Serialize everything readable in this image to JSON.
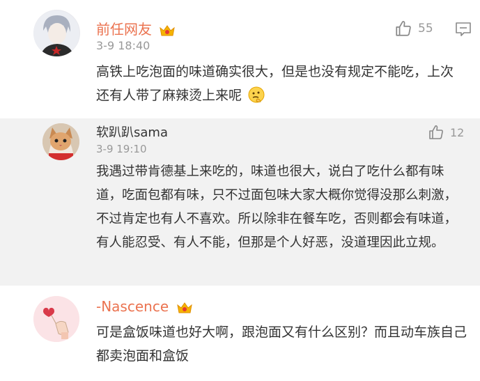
{
  "comments": [
    {
      "username": "前任网友",
      "time": "3-9 18:40",
      "likes": "55",
      "text": "高铁上吃泡面的味道确实很大，但是也没有规定不能吃，上次还有人带了麻辣烫上来呢",
      "emoji": "thinking-emoji",
      "name_color": "#eb7350"
    },
    {
      "username": "软趴趴sama",
      "time": "3-9 19:10",
      "likes": "12",
      "text": "我遇过带肯德基上来吃的，味道也很大，说白了吃什么都有味道，吃面包都有味，只不过面包味大家大概你觉得没那么刺激，不过肯定也有人不喜欢。所以除非在餐车吃，否则都会有味道，有人能忍受、有人不能，但那是个人好恶，没道理因此立规。",
      "name_color": "#333333"
    },
    {
      "username": "-Nascence",
      "text": "可是盒饭味道也好大啊，跟泡面又有什么区别？而且动车族自己都卖泡面和盒饭",
      "name_color": "#eb7350"
    }
  ]
}
